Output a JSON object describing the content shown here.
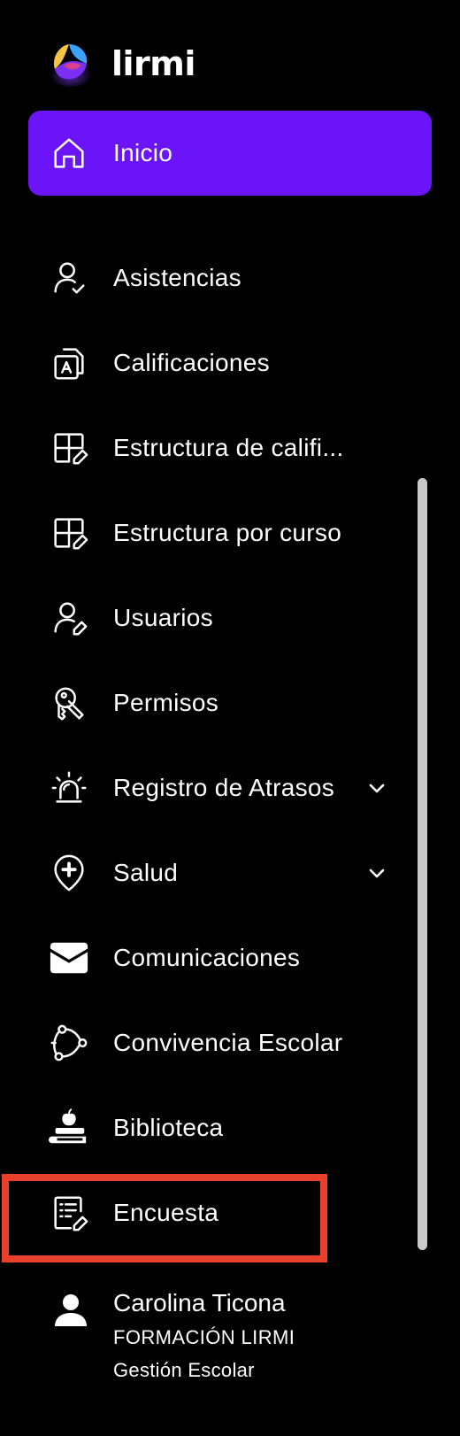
{
  "app": {
    "logo_text": "lirmi"
  },
  "colors": {
    "active_bg": "#6b14fa",
    "highlight": "#e8402a",
    "scrollbar": "#c9c9c9"
  },
  "nav": {
    "items": [
      {
        "label": "Inicio",
        "icon": "home-icon",
        "active": true
      },
      {
        "label": "Asistencias",
        "icon": "user-check-icon"
      },
      {
        "label": "Calificaciones",
        "icon": "grades-document-icon"
      },
      {
        "label": "Estructura de califi...",
        "icon": "grid-edit-icon"
      },
      {
        "label": "Estructura por curso",
        "icon": "grid-edit-icon"
      },
      {
        "label": "Usuarios",
        "icon": "user-edit-icon"
      },
      {
        "label": "Permisos",
        "icon": "key-permissions-icon"
      },
      {
        "label": "Registro de Atrasos",
        "icon": "alarm-light-icon",
        "expandable": true
      },
      {
        "label": "Salud",
        "icon": "health-plus-icon",
        "expandable": true
      },
      {
        "label": "Comunicaciones",
        "icon": "envelope-icon"
      },
      {
        "label": "Convivencia Escolar",
        "icon": "network-icon"
      },
      {
        "label": "Biblioteca",
        "icon": "books-apple-icon"
      },
      {
        "label": "Encuesta",
        "icon": "survey-edit-icon",
        "highlighted": true
      }
    ]
  },
  "user": {
    "name": "Carolina Ticona",
    "organization": "FORMACIÓN LIRMI",
    "role": "Gestión Escolar",
    "icon": "user-icon"
  }
}
